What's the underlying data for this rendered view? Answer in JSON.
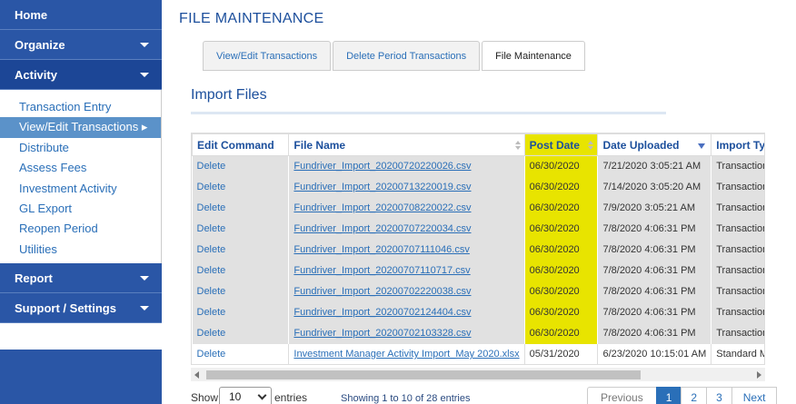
{
  "sidebar": {
    "sections": [
      {
        "label": "Home",
        "caret": false
      },
      {
        "label": "Organize",
        "caret": true
      },
      {
        "label": "Activity",
        "caret": true
      }
    ],
    "activity_items": [
      "Transaction Entry",
      "View/Edit Transactions",
      "Distribute",
      "Assess Fees",
      "Investment Activity",
      "GL Export",
      "Reopen Period",
      "Utilities"
    ],
    "selected_item_suffix": " ▸",
    "bottom_sections": [
      {
        "label": "Report"
      },
      {
        "label": "Support / Settings"
      }
    ]
  },
  "page_title": "FILE MAINTENANCE",
  "tabs": [
    {
      "label": "View/Edit Transactions",
      "active": false
    },
    {
      "label": "Delete Period Transactions",
      "active": false
    },
    {
      "label": "File Maintenance",
      "active": true
    }
  ],
  "section_title": "Import Files",
  "table": {
    "columns": [
      "Edit Command",
      "File Name",
      "Post Date",
      "Date Uploaded",
      "Import Type"
    ],
    "rows": [
      [
        "Delete",
        "Fundriver_Import_20200720220026.csv",
        "06/30/2020",
        "7/21/2020 3:05:21 AM",
        "Transaction A"
      ],
      [
        "Delete",
        "Fundriver_Import_20200713220019.csv",
        "06/30/2020",
        "7/14/2020 3:05:20 AM",
        "Transaction A"
      ],
      [
        "Delete",
        "Fundriver_Import_20200708220022.csv",
        "06/30/2020",
        "7/9/2020 3:05:21 AM",
        "Transaction A"
      ],
      [
        "Delete",
        "Fundriver_Import_20200707220034.csv",
        "06/30/2020",
        "7/8/2020 4:06:31 PM",
        "Transaction A"
      ],
      [
        "Delete",
        "Fundriver_Import_20200707111046.csv",
        "06/30/2020",
        "7/8/2020 4:06:31 PM",
        "Transaction A"
      ],
      [
        "Delete",
        "Fundriver_Import_20200707110717.csv",
        "06/30/2020",
        "7/8/2020 4:06:31 PM",
        "Transaction A"
      ],
      [
        "Delete",
        "Fundriver_Import_20200702220038.csv",
        "06/30/2020",
        "7/8/2020 4:06:31 PM",
        "Transaction A"
      ],
      [
        "Delete",
        "Fundriver_Import_20200702124404.csv",
        "06/30/2020",
        "7/8/2020 4:06:31 PM",
        "Transaction A"
      ],
      [
        "Delete",
        "Fundriver_Import_20200702103328.csv",
        "06/30/2020",
        "7/8/2020 4:06:31 PM",
        "Transaction A"
      ],
      [
        "Delete",
        "Investment Manager Activity Import_May 2020.xlsx",
        "05/31/2020",
        "6/23/2020 10:15:01 AM",
        "Standard Ma"
      ]
    ]
  },
  "footer": {
    "show_label": "Show",
    "page_size": "10",
    "entries_label": "entries",
    "info": "Showing 1 to 10 of 28 entries",
    "pagination": {
      "previous": "Previous",
      "pages": [
        "1",
        "2",
        "3"
      ],
      "current": "1",
      "next": "Next"
    }
  },
  "colors": {
    "sidebar_blue": "#2a56a6",
    "highlight": "#e8e400",
    "link": "#2a6fb8"
  }
}
